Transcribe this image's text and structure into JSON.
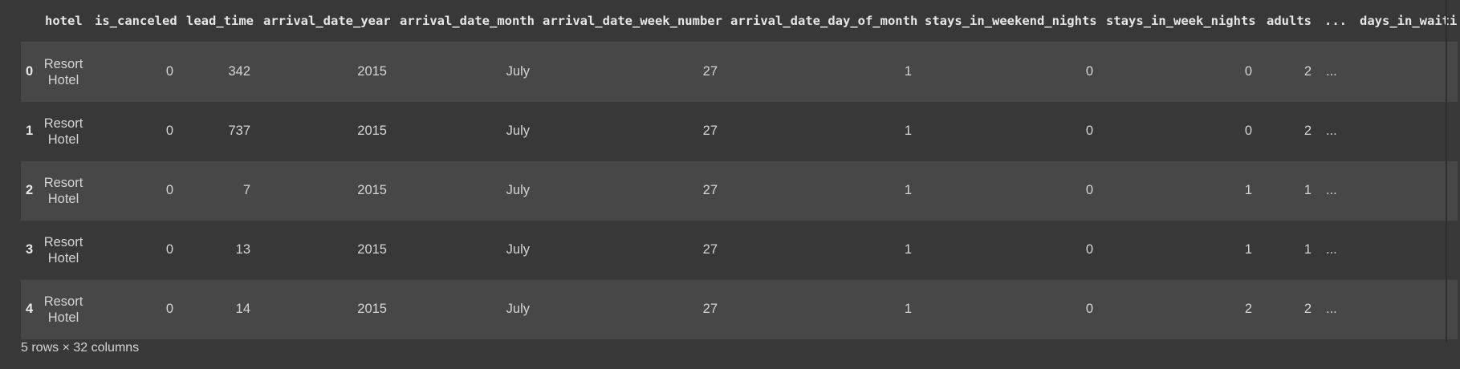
{
  "table": {
    "columns": [
      "",
      "hotel",
      "is_canceled",
      "lead_time",
      "arrival_date_year",
      "arrival_date_month",
      "arrival_date_week_number",
      "arrival_date_day_of_month",
      "stays_in_weekend_nights",
      "stays_in_week_nights",
      "adults",
      "...",
      "days_in_waiting"
    ],
    "rows": [
      {
        "index": "0",
        "hotel": "Resort Hotel",
        "is_canceled": "0",
        "lead_time": "342",
        "arrival_date_year": "2015",
        "arrival_date_month": "July",
        "arrival_date_week_number": "27",
        "arrival_date_day_of_month": "1",
        "stays_in_weekend_nights": "0",
        "stays_in_week_nights": "0",
        "adults": "2",
        "ellipsis": "..."
      },
      {
        "index": "1",
        "hotel": "Resort Hotel",
        "is_canceled": "0",
        "lead_time": "737",
        "arrival_date_year": "2015",
        "arrival_date_month": "July",
        "arrival_date_week_number": "27",
        "arrival_date_day_of_month": "1",
        "stays_in_weekend_nights": "0",
        "stays_in_week_nights": "0",
        "adults": "2",
        "ellipsis": "..."
      },
      {
        "index": "2",
        "hotel": "Resort Hotel",
        "is_canceled": "0",
        "lead_time": "7",
        "arrival_date_year": "2015",
        "arrival_date_month": "July",
        "arrival_date_week_number": "27",
        "arrival_date_day_of_month": "1",
        "stays_in_weekend_nights": "0",
        "stays_in_week_nights": "1",
        "adults": "1",
        "ellipsis": "..."
      },
      {
        "index": "3",
        "hotel": "Resort Hotel",
        "is_canceled": "0",
        "lead_time": "13",
        "arrival_date_year": "2015",
        "arrival_date_month": "July",
        "arrival_date_week_number": "27",
        "arrival_date_day_of_month": "1",
        "stays_in_weekend_nights": "0",
        "stays_in_week_nights": "1",
        "adults": "1",
        "ellipsis": "..."
      },
      {
        "index": "4",
        "hotel": "Resort Hotel",
        "is_canceled": "0",
        "lead_time": "14",
        "arrival_date_year": "2015",
        "arrival_date_month": "July",
        "arrival_date_week_number": "27",
        "arrival_date_day_of_month": "1",
        "stays_in_weekend_nights": "0",
        "stays_in_week_nights": "2",
        "adults": "2",
        "ellipsis": "..."
      }
    ]
  },
  "footer": {
    "shape_text": "5 rows × 32 columns"
  },
  "colors": {
    "background": "#383838",
    "row_odd": "#474747",
    "row_even": "#383838",
    "text": "#d5d5d5"
  }
}
